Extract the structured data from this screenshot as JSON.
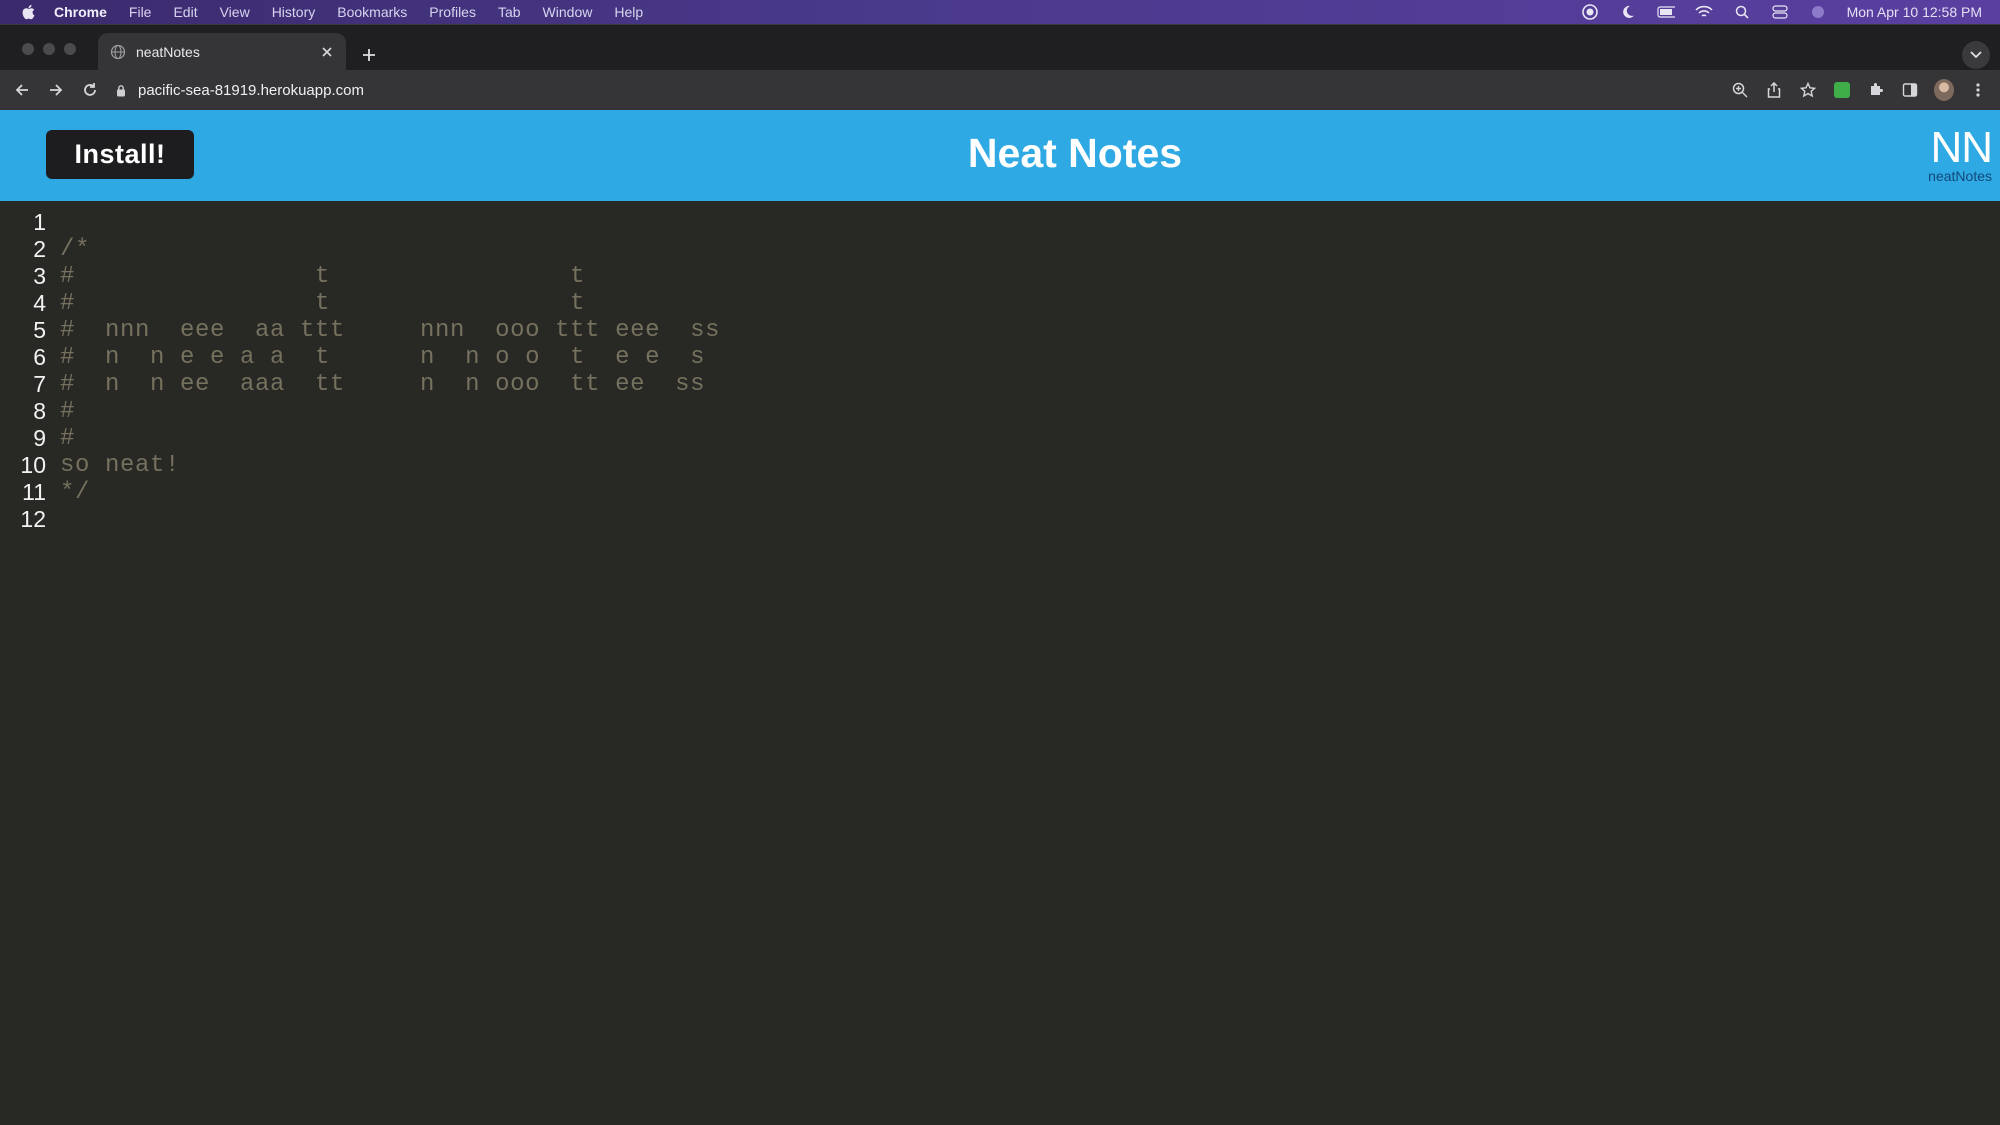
{
  "menubar": {
    "app_name": "Chrome",
    "items": [
      "File",
      "Edit",
      "View",
      "History",
      "Bookmarks",
      "Profiles",
      "Tab",
      "Window",
      "Help"
    ],
    "clock": "Mon Apr 10  12:58 PM"
  },
  "browser": {
    "tab_title": "neatNotes",
    "url": "pacific-sea-81919.herokuapp.com"
  },
  "app": {
    "install_label": "Install!",
    "title": "Neat Notes",
    "logo_mark": "NN",
    "logo_text": "neatNotes"
  },
  "editor": {
    "lines": [
      {
        "number": "1",
        "text": ""
      },
      {
        "number": "2",
        "text": "/*"
      },
      {
        "number": "3",
        "text": "#                t                t"
      },
      {
        "number": "4",
        "text": "#                t                t"
      },
      {
        "number": "5",
        "text": "#  nnn  eee  aa ttt     nnn  ooo ttt eee  ss"
      },
      {
        "number": "6",
        "text": "#  n  n e e a a  t      n  n o o  t  e e  s"
      },
      {
        "number": "7",
        "text": "#  n  n ee  aaa  tt     n  n ooo  tt ee  ss"
      },
      {
        "number": "8",
        "text": "#"
      },
      {
        "number": "9",
        "text": "#"
      },
      {
        "number": "10",
        "text": "so neat!"
      },
      {
        "number": "11",
        "text": "*/"
      },
      {
        "number": "12",
        "text": ""
      }
    ]
  },
  "colors": {
    "header_bg": "#2ea9e3",
    "editor_bg": "#282825",
    "comment_text": "#75715e"
  }
}
